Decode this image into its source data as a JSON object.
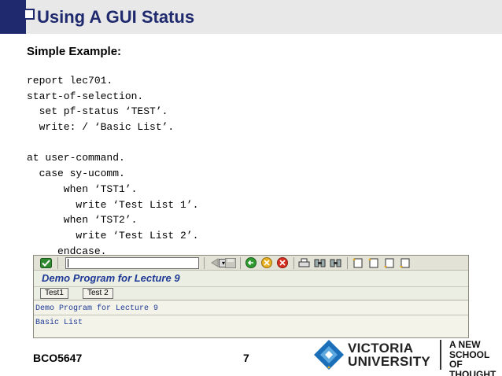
{
  "slide": {
    "title": "Using A GUI Status",
    "subtitle": "Simple Example:",
    "code_lines": [
      "report lec701.",
      "start-of-selection.",
      "  set pf-status ‘TEST’.",
      "  write: / ‘Basic List’.",
      "",
      "at user-command.",
      "  case sy-ucomm.",
      "      when ‘TST1’.",
      "        write ‘Test List 1’.",
      "      when ‘TST2’.",
      "        write ‘Test List 2’.",
      "     endcase."
    ],
    "footer": {
      "course_code": "BCO5647",
      "page_number": "7"
    }
  },
  "gui": {
    "program_title": "Demo Program for Lecture 9",
    "command_field_value": "",
    "toolbar_icons": [
      "enter-check-icon",
      "command-dropdown-icon",
      "back-arrow-icon",
      "save-icon",
      "green-back-icon",
      "exit-icon",
      "cancel-icon",
      "print-icon",
      "find-icon",
      "find-next-icon",
      "first-page-icon",
      "previous-page-icon",
      "next-page-icon",
      "last-page-icon"
    ],
    "app_buttons": [
      "Test1",
      "Test 2"
    ],
    "list_header": "Demo Program for Lecture 9",
    "list_lines": [
      "Basic List"
    ]
  },
  "branding": {
    "university_line1": "VICTORIA",
    "university_line2": "UNIVERSITY",
    "tagline_line1": "A NEW",
    "tagline_line2": "SCHOOL OF",
    "tagline_line3": "THOUGHT"
  },
  "colors": {
    "title_navy": "#1f2a6e",
    "sap_blue_text": "#1e3a96",
    "logo_blue": "#1b6fb8",
    "logo_light_blue": "#5ea8e0"
  }
}
